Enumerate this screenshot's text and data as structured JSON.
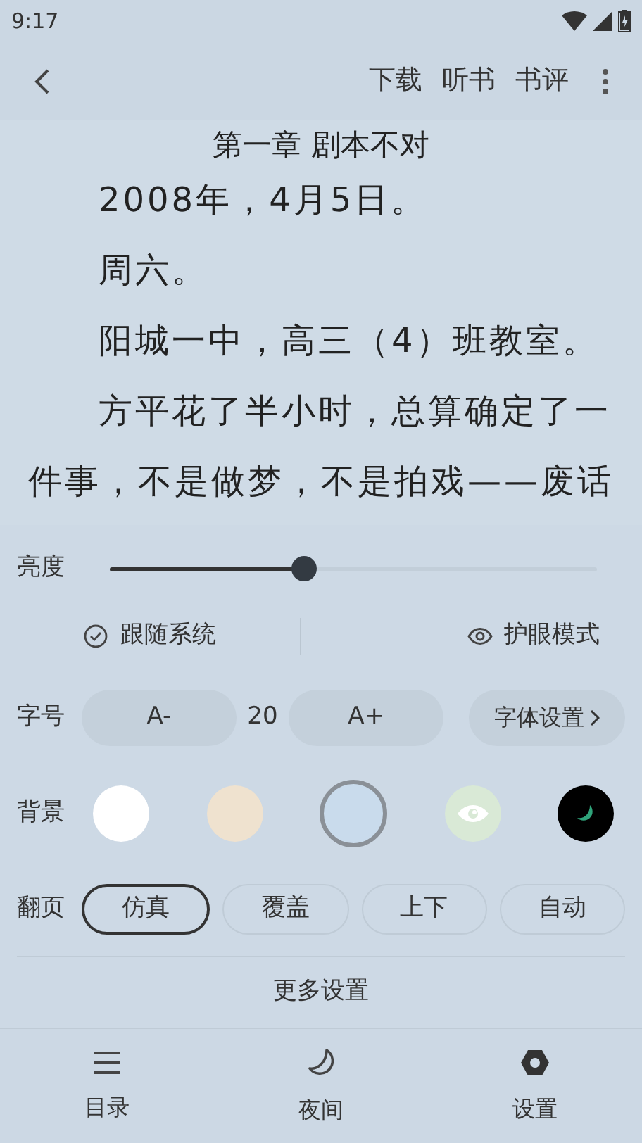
{
  "status_bar": {
    "time": "9:17"
  },
  "toolbar": {
    "actions": [
      "下载",
      "听书",
      "书评"
    ]
  },
  "reader": {
    "title": "第一章 剧本不对",
    "paragraphs": [
      "2008年，4月5日。",
      "周六。",
      "阳城一中，高三（4）班教室。",
      "方平花了半小时，总算确定了一件事，不是做梦，不是拍戏——废话"
    ]
  },
  "brightness": {
    "label": "亮度",
    "level": 0.4
  },
  "light_options": [
    {
      "kind": "check",
      "label": "跟随系统"
    },
    {
      "kind": "eye",
      "label": "护眼模式"
    }
  ],
  "font_size": {
    "label": "字号",
    "decrease": "A-",
    "value": "20",
    "increase": "A+",
    "font_settings": "字体设置"
  },
  "background": {
    "label": "背景",
    "swatches": [
      {
        "kind": "plain",
        "color": "#ffffff",
        "selected": false
      },
      {
        "kind": "plain",
        "color": "#efe2cf",
        "selected": false
      },
      {
        "kind": "plain",
        "color": "#c9dbec",
        "selected": true
      },
      {
        "kind": "eye",
        "color": "#d9e9d6",
        "selected": false
      },
      {
        "kind": "moon",
        "color": "#000000",
        "selected": false
      }
    ]
  },
  "page_turn": {
    "label": "翻页",
    "options": [
      {
        "label": "仿真",
        "selected": true
      },
      {
        "label": "覆盖",
        "selected": false
      },
      {
        "label": "上下",
        "selected": false
      },
      {
        "label": "自动",
        "selected": false
      }
    ]
  },
  "more_settings": "更多设置",
  "bottom_nav": [
    {
      "kind": "list",
      "label": "目录"
    },
    {
      "kind": "moon",
      "label": "夜间"
    },
    {
      "kind": "gear",
      "label": "设置"
    }
  ]
}
